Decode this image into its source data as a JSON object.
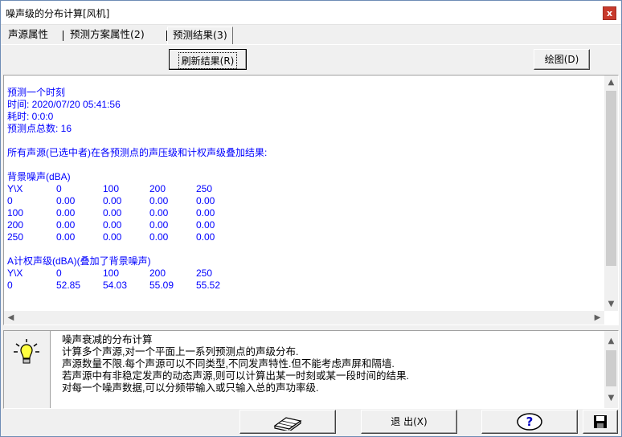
{
  "window": {
    "title": "噪声级的分布计算[风机]",
    "close_label": "x"
  },
  "tabs": [
    {
      "label": "声源属性"
    },
    {
      "label": "预测方案属性(2)"
    },
    {
      "label": "预测结果(3)"
    }
  ],
  "toolbar": {
    "refresh_label": "刷新结果(R)",
    "plot_label": "绘图(D)"
  },
  "results": {
    "header_lines": [
      "预测一个时刻",
      "时间: 2020/07/20 05:41:56",
      "耗时: 0:0:0",
      "预测点总数: 16"
    ],
    "summary_line": "所有声源(已选中者)在各预测点的声压级和计权声级叠加结果:",
    "background_table": {
      "title": "背景噪声(dBA)",
      "header": [
        "Y\\X",
        "0",
        "100",
        "200",
        "250"
      ],
      "rows": [
        [
          "0",
          "0.00",
          "0.00",
          "0.00",
          "0.00"
        ],
        [
          "100",
          "0.00",
          "0.00",
          "0.00",
          "0.00"
        ],
        [
          "200",
          "0.00",
          "0.00",
          "0.00",
          "0.00"
        ],
        [
          "250",
          "0.00",
          "0.00",
          "0.00",
          "0.00"
        ]
      ]
    },
    "weighted_table": {
      "title": "A计权声级(dBA)(叠加了背景噪声)",
      "header": [
        "Y\\X",
        "0",
        "100",
        "200",
        "250"
      ],
      "rows": [
        [
          "0",
          "52.85",
          "54.03",
          "55.09",
          "55.52"
        ]
      ]
    }
  },
  "info": {
    "lines": [
      "噪声衰减的分布计算",
      "计算多个声源,对一个平面上一系列预测点的声级分布.",
      "声源数量不限.每个声源可以不同类型,不同发声特性.但不能考虑声屏和隔墙.",
      "若声源中有非稳定发声的动态声源,则可以计算出某一时刻或某一段时间的结果.",
      "对每一个噪声数据,可以分频带输入或只输入总的声功率级."
    ]
  },
  "bottom": {
    "exit_label": "退 出(X)",
    "help_glyph": "?"
  }
}
